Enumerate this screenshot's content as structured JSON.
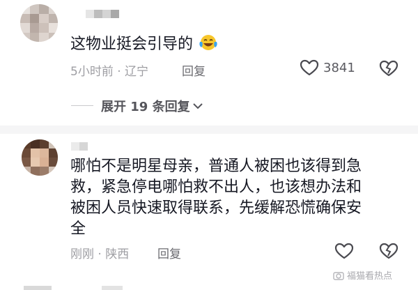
{
  "comments": [
    {
      "text": "这物业挺会引导的",
      "time_location": "5小时前 · 辽宁",
      "reply_label": "回复",
      "like_count": "3841",
      "emoji": "laughing-tears"
    },
    {
      "text_lines": [
        "哪怕不是明星母亲，普通人被困也该得到急",
        "救，紧急停电哪怕救不出人，也该想办法和",
        "被困人员快速取得联系，先缓解恐慌确保安",
        "全"
      ],
      "time_location": "刚刚 · 陕西",
      "reply_label": "回复"
    }
  ],
  "expand_replies": "展开 19 条回复",
  "watermark": "福猫看热点",
  "colors": {
    "text": "#161823",
    "meta": "#9e9ea3",
    "accent": "#f5c518"
  }
}
